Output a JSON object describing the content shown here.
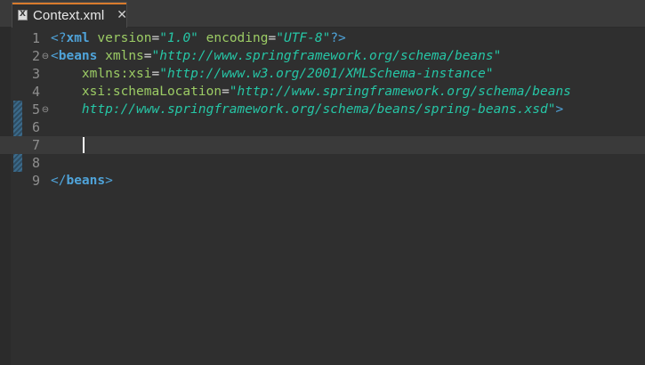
{
  "tab": {
    "title": "Context.xml",
    "close_glyph": "✕",
    "icon": "xml-file-icon"
  },
  "editor": {
    "lines": [
      {
        "number": "1",
        "fold": "",
        "tokens": [
          {
            "c": "t-bracket",
            "t": "<?"
          },
          {
            "c": "t-tag",
            "t": "xml"
          },
          {
            "c": "t-eq",
            "t": " "
          },
          {
            "c": "t-attr",
            "t": "version"
          },
          {
            "c": "t-eq",
            "t": "="
          },
          {
            "c": "t-str",
            "t": "\"1.0\""
          },
          {
            "c": "t-eq",
            "t": " "
          },
          {
            "c": "t-attr",
            "t": "encoding"
          },
          {
            "c": "t-eq",
            "t": "="
          },
          {
            "c": "t-str",
            "t": "\"UTF-8\""
          },
          {
            "c": "t-bracket",
            "t": "?>"
          }
        ]
      },
      {
        "number": "2",
        "fold": "⊖",
        "tokens": [
          {
            "c": "t-bracket",
            "t": "<"
          },
          {
            "c": "t-tag",
            "t": "beans"
          },
          {
            "c": "t-eq",
            "t": " "
          },
          {
            "c": "t-attr",
            "t": "xmlns"
          },
          {
            "c": "t-eq",
            "t": "="
          },
          {
            "c": "t-str",
            "t": "\"http://www.springframework.org/schema/beans\""
          }
        ]
      },
      {
        "number": "3",
        "fold": "",
        "tokens": [
          {
            "c": "t-eq",
            "t": "    "
          },
          {
            "c": "t-attr",
            "t": "xmlns:xsi"
          },
          {
            "c": "t-eq",
            "t": "="
          },
          {
            "c": "t-str",
            "t": "\"http://www.w3.org/2001/XMLSchema-instance\""
          }
        ]
      },
      {
        "number": "4",
        "fold": "",
        "tokens": [
          {
            "c": "t-eq",
            "t": "    "
          },
          {
            "c": "t-attr",
            "t": "xsi:schemaLocation"
          },
          {
            "c": "t-eq",
            "t": "="
          },
          {
            "c": "t-str",
            "t": "\"http://www.springframework.org/schema/beans"
          }
        ]
      },
      {
        "number": "5",
        "fold": "⊖",
        "tokens": [
          {
            "c": "t-eq",
            "t": "    "
          },
          {
            "c": "t-str",
            "t": "http://www.springframework.org/schema/beans/spring-beans.xsd\""
          },
          {
            "c": "t-bracket",
            "t": ">"
          }
        ]
      },
      {
        "number": "6",
        "fold": "",
        "tokens": []
      },
      {
        "number": "7",
        "fold": "",
        "tokens": [],
        "current": true
      },
      {
        "number": "8",
        "fold": "",
        "tokens": []
      },
      {
        "number": "9",
        "fold": "",
        "tokens": [
          {
            "c": "t-bracket",
            "t": "</"
          },
          {
            "c": "t-tag",
            "t": "beans"
          },
          {
            "c": "t-bracket",
            "t": ">"
          }
        ]
      }
    ]
  }
}
